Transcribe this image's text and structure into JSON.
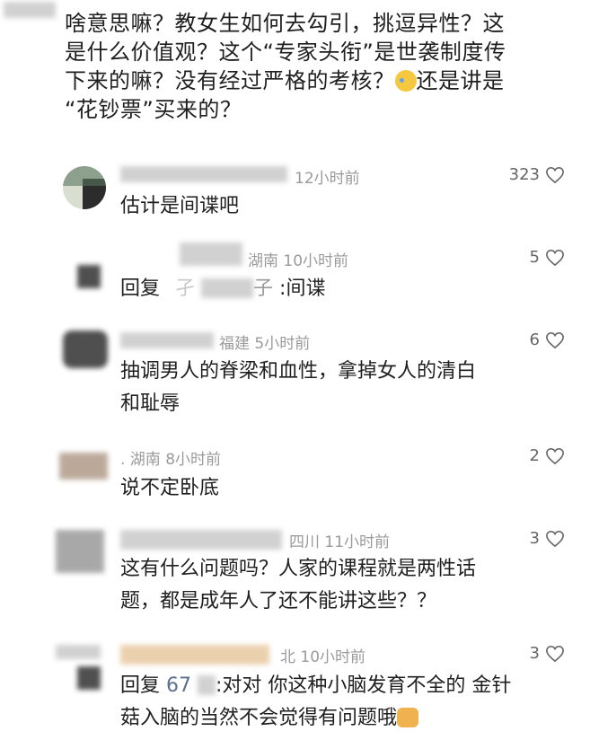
{
  "post": {
    "text_lines": [
      "啥意思嘛？教女生如何去勾引，挑逗异性？这",
      "是什么价值观？这个“专家头衔”是世袭制度传",
      "下来的嘛？没有经过严格的考核？",
      "“花钞票”买来的？"
    ],
    "text_line3_suffix": "还是讲是"
  },
  "comments": [
    {
      "meta": "12小时前",
      "likes": "323",
      "text": "估计是间谍吧"
    },
    {
      "meta": "湖南 10小时前",
      "likes": "5",
      "text_prefix": "回复",
      "text_mid": "子",
      "text_suffix": ":间谍",
      "text_obscured_char": "孑"
    },
    {
      "meta": "福建 5小时前",
      "likes": "6",
      "text_lines": [
        "抽调男人的脊梁和血性，拿掉女人的清白",
        "和耻辱"
      ]
    },
    {
      "meta": ". 湖南 8小时前",
      "likes": "2",
      "text": "说不定卧底"
    },
    {
      "meta": "四川 11小时前",
      "likes": "3",
      "text_lines": [
        "这有什么问题吗？人家的课程就是两性话",
        "题，都是成年人了还不能讲这些？？"
      ]
    },
    {
      "meta": "北 10小时前",
      "likes": "3",
      "text_prefix": "回复",
      "text_mention": "67",
      "text_line1_rest": ":对对 你这种小脑发育不全的 金针",
      "text_line2": "菇入脑的当然不会觉得有问题哦"
    }
  ],
  "icons": {
    "heart": "heart-outline-icon",
    "emoji_cry": "crying-face-emoji-icon",
    "emoji_dog": "dog-face-emoji-icon"
  },
  "colors": {
    "meta": "#9a9a9a",
    "text": "#1f1f1f",
    "icon": "#666666"
  }
}
